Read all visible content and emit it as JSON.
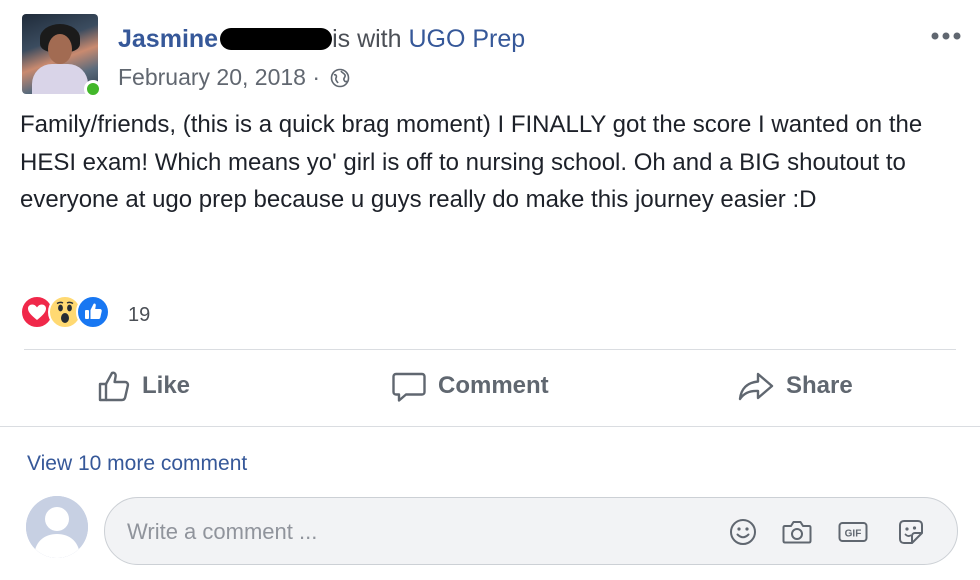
{
  "post": {
    "author_name": "Jasmine",
    "with_text": "is with",
    "page_name": "UGO Prep",
    "date": "February 20, 2018",
    "separator": "·",
    "globe_icon": "globe-icon",
    "more_icon": "more-options-icon",
    "text": "Family/friends, (this is a quick brag moment) I FINALLY got the score I wanted on the HESI exam! Which means yo' girl is off to nursing school. Oh and a BIG shoutout to everyone at ugo prep because u guys really do make this journey easier :D"
  },
  "reactions": {
    "icons": [
      "love-reaction-icon",
      "wow-reaction-icon",
      "like-reaction-icon"
    ],
    "count": "19"
  },
  "actions": {
    "like": "Like",
    "comment": "Comment",
    "share": "Share"
  },
  "comments": {
    "view_more": "View 10 more comment",
    "placeholder": "Write a comment ...",
    "tools": [
      "emoji-icon",
      "camera-icon",
      "gif-icon",
      "sticker-icon"
    ]
  },
  "colors": {
    "link": "#365899",
    "online": "#42b72a",
    "love": "#f0284a",
    "wow": "#ffd972",
    "like": "#1877f2",
    "muted": "#606770"
  }
}
